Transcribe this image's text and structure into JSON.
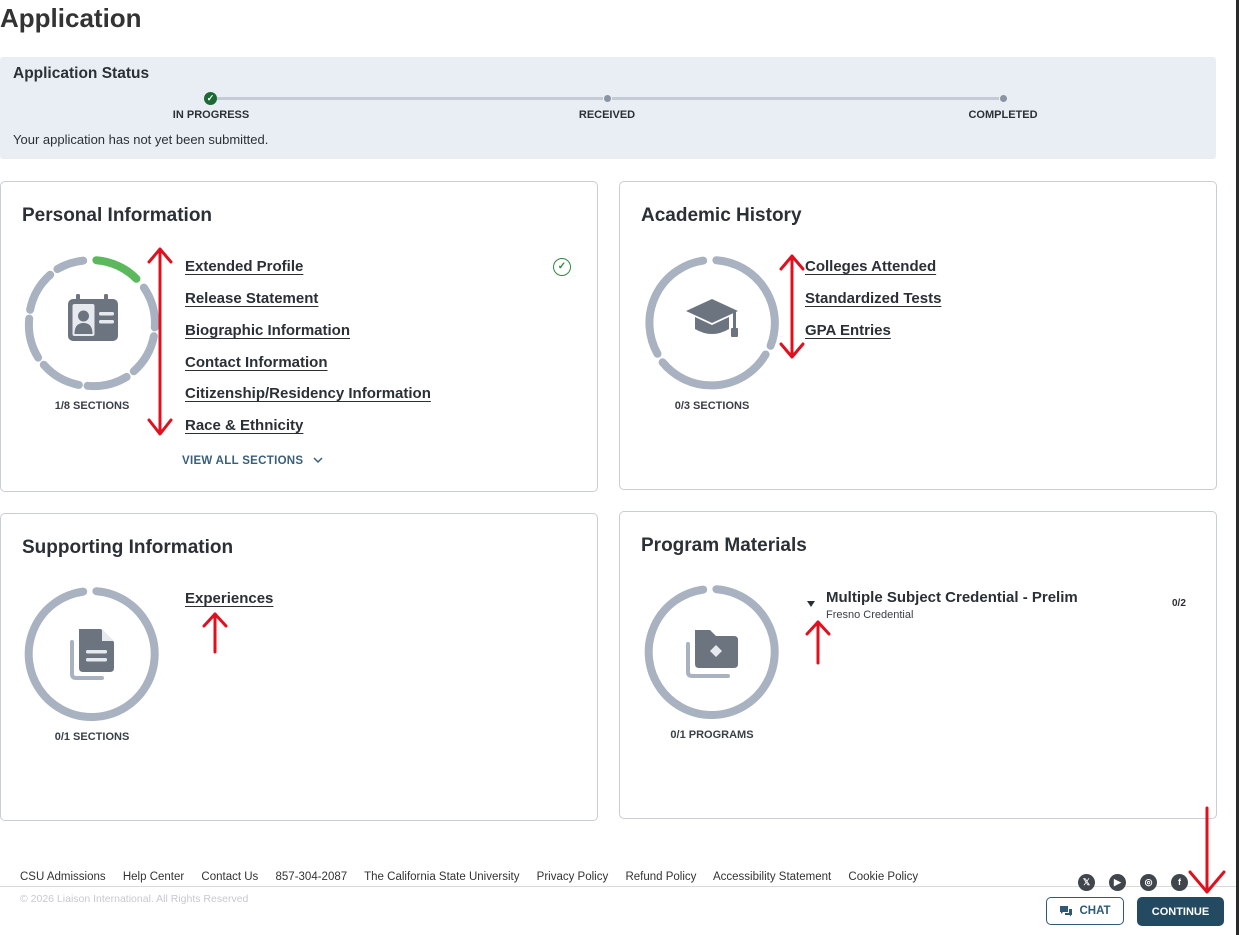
{
  "page": {
    "title": "Application"
  },
  "status": {
    "title": "Application Status",
    "steps": [
      {
        "label": "IN PROGRESS",
        "state": "done"
      },
      {
        "label": "RECEIVED",
        "state": "pending"
      },
      {
        "label": "COMPLETED",
        "state": "pending"
      }
    ],
    "message": "Your application has not yet been submitted."
  },
  "personal": {
    "title": "Personal Information",
    "progress_label": "1/8 SECTIONS",
    "completed": 1,
    "total": 8,
    "icon": "id-badge-icon",
    "links": [
      "Extended Profile",
      "Release Statement",
      "Biographic Information",
      "Contact Information",
      "Citizenship/Residency Information",
      "Race & Ethnicity"
    ],
    "view_all": "VIEW ALL SECTIONS"
  },
  "academic": {
    "title": "Academic History",
    "progress_label": "0/3 SECTIONS",
    "completed": 0,
    "total": 3,
    "icon": "graduation-cap-icon",
    "links": [
      "Colleges Attended",
      "Standardized Tests",
      "GPA Entries"
    ]
  },
  "supporting": {
    "title": "Supporting Information",
    "progress_label": "0/1 SECTIONS",
    "completed": 0,
    "total": 1,
    "icon": "documents-icon",
    "links": [
      "Experiences"
    ]
  },
  "program": {
    "title": "Program Materials",
    "progress_label": "0/1 PROGRAMS",
    "completed": 0,
    "total": 1,
    "icon": "folder-icon",
    "program_name": "Multiple Subject Credential - Prelim",
    "program_sub": "Fresno Credential",
    "program_count": "0/2"
  },
  "footer": {
    "links": [
      "CSU Admissions",
      "Help Center",
      "Contact Us",
      "857-304-2087",
      "The California State University",
      "Privacy Policy",
      "Refund Policy",
      "Accessibility Statement",
      "Cookie Policy"
    ],
    "copyright": "© 2026 Liaison International. All Rights Reserved",
    "social": [
      "x-icon",
      "youtube-icon",
      "instagram-icon",
      "facebook-icon"
    ]
  },
  "actions": {
    "chat": "CHAT",
    "continue": "CONTINUE"
  },
  "colors": {
    "accent": "#234a61",
    "success": "#2d8a3e",
    "ring": "#a9b2c0",
    "annotation": "#e0101e"
  }
}
